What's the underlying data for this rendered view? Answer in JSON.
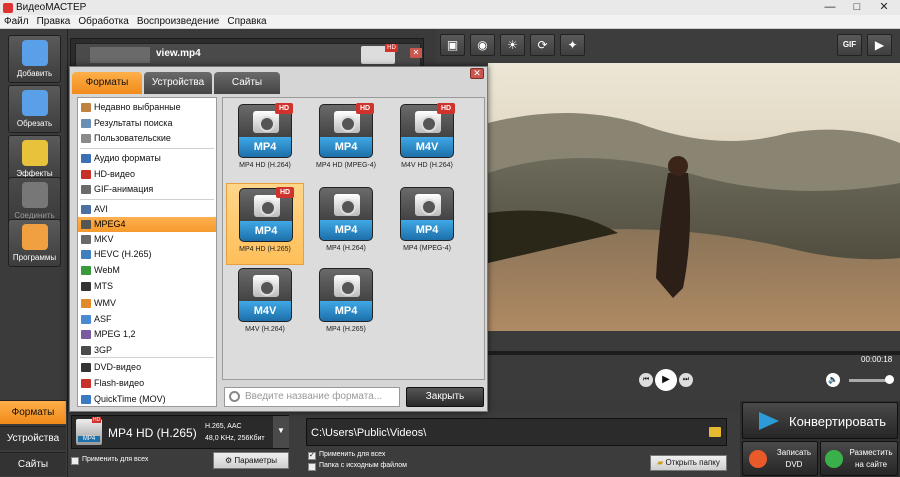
{
  "window": {
    "title": "ВидеоМАСТЕР",
    "min": "—",
    "max": "□",
    "close": "✕"
  },
  "menu": [
    "Файл",
    "Правка",
    "Обработка",
    "Воспроизведение",
    "Справка"
  ],
  "sidebar": {
    "items": [
      {
        "label": "Добавить",
        "icon": "add-film-icon",
        "color": "#5aa0e8"
      },
      {
        "label": "Обрезать",
        "icon": "scissors-icon",
        "color": "#5aa0e8"
      },
      {
        "label": "Эффекты",
        "icon": "effects-icon",
        "color": "#e8c23a"
      },
      {
        "label": "Соединить",
        "icon": "join-icon",
        "color": "#777777"
      },
      {
        "label": "Программы",
        "icon": "programs-icon",
        "color": "#f0a040"
      }
    ],
    "bottom_tabs": [
      "Форматы",
      "Устройства",
      "Сайты"
    ]
  },
  "file": {
    "name": "view.mp4",
    "badge": "HD"
  },
  "tools": [
    "crop-icon",
    "stabilize-icon",
    "brightness-icon",
    "rotate-icon",
    "speed-icon",
    "gif-icon",
    "snapshot-icon"
  ],
  "gif_label": "GIF",
  "player": {
    "time": "00:00:18"
  },
  "dialog": {
    "tabs": [
      "Форматы",
      "Устройства",
      "Сайты"
    ],
    "close": "✕",
    "categories": [
      {
        "label": "Недавно выбранные",
        "color": "#c08040"
      },
      {
        "label": "Результаты поиска",
        "color": "#6a8fb5"
      },
      {
        "label": "Пользовательские",
        "color": "#8a8a8a"
      },
      {
        "label": "Аудио форматы",
        "color": "#3b6fb6"
      },
      {
        "label": "HD-видео",
        "color": "#c8302a"
      },
      {
        "label": "GIF-анимация",
        "color": "#6a6a6a"
      },
      {
        "label": "AVI",
        "color": "#4a6fa0"
      },
      {
        "label": "MPEG4",
        "color": "#555555"
      },
      {
        "label": "MKV",
        "color": "#6a6a6a"
      },
      {
        "label": "HEVC (H.265)",
        "color": "#3f7fc0"
      },
      {
        "label": "WebM",
        "color": "#3a9a3a"
      },
      {
        "label": "MTS",
        "color": "#333333"
      },
      {
        "label": "WMV",
        "color": "#e08a2a"
      },
      {
        "label": "ASF",
        "color": "#4a8ad0"
      },
      {
        "label": "MPEG 1,2",
        "color": "#7a5aa0"
      },
      {
        "label": "3GP",
        "color": "#4a4a4a"
      },
      {
        "label": "DVD-видео",
        "color": "#333333"
      },
      {
        "label": "Flash-видео",
        "color": "#c8302a"
      },
      {
        "label": "QuickTime (MOV)",
        "color": "#3a7ac0"
      }
    ],
    "formats": [
      {
        "tag": "MP4",
        "name": "MP4 HD (H.264)",
        "hd": "HD"
      },
      {
        "tag": "MP4",
        "name": "MP4 HD (MPEG-4)",
        "hd": "HD"
      },
      {
        "tag": "M4V",
        "name": "M4V HD (H.264)",
        "hd": "HD"
      },
      {
        "tag": "MP4",
        "name": "MP4 HD (H.265)",
        "hd": "HD"
      },
      {
        "tag": "MP4",
        "name": "MP4 (H.264)",
        "hd": ""
      },
      {
        "tag": "MP4",
        "name": "MP4 (MPEG-4)",
        "hd": ""
      },
      {
        "tag": "M4V",
        "name": "M4V (H.264)",
        "hd": ""
      },
      {
        "tag": "MP4",
        "name": "MP4 (H.265)",
        "hd": ""
      }
    ],
    "search_placeholder": "Введите название формата...",
    "close_label": "Закрыть"
  },
  "output": {
    "format_name": "MP4 HD (H.265)",
    "format_icon_label": "MP4",
    "format_hd": "HD",
    "spec_line1": "H.265, AAC",
    "spec_line2": "48,0 KHz, 256Кбит",
    "apply_all": "Применить для всех",
    "params_label": "Параметры",
    "path": "C:\\Users\\Public\\Videos\\",
    "apply_all_2": "Применить для всех",
    "source_folder": "Папка с исходным файлом",
    "open_folder": "Открыть папку"
  },
  "actions": {
    "convert": "Конвертировать",
    "dvd_line1": "Записать",
    "dvd_line2": "DVD",
    "web_line1": "Разместить",
    "web_line2": "на сайте"
  }
}
